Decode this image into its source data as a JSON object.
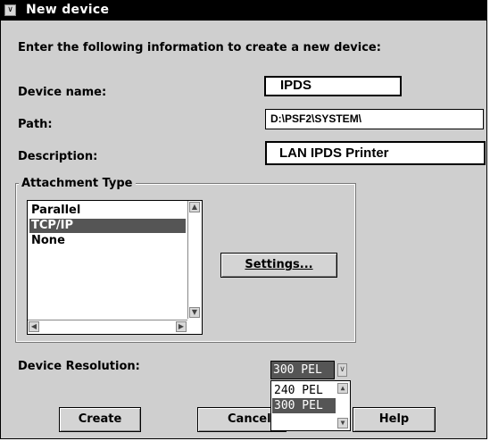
{
  "window": {
    "title": "New device",
    "system_menu_glyph": "∨"
  },
  "instructions": "Enter the following information to create a new device:",
  "form": {
    "device_name": {
      "label": "Device name:",
      "value": "IPDS"
    },
    "path": {
      "label": "Path:",
      "value": "D:\\PSF2\\SYSTEM\\"
    },
    "description": {
      "label": "Description:",
      "value": "LAN IPDS Printer"
    }
  },
  "attachment_type": {
    "title": "Attachment Type",
    "options": [
      "Parallel",
      "TCP/IP",
      "None"
    ],
    "selected": "TCP/IP",
    "settings_button": "Settings...",
    "arrows": {
      "up": "▲",
      "down": "▼",
      "left": "◀",
      "right": "▶"
    }
  },
  "resolution": {
    "label": "Device Resolution:",
    "value": "300 PEL",
    "options": [
      "240 PEL",
      "300 PEL"
    ],
    "selected": "300 PEL",
    "arrows": {
      "drop": "∨",
      "up": "▲",
      "down": "▼"
    }
  },
  "buttons": {
    "create": "Create",
    "cancel": "Cancel",
    "help": "Help"
  }
}
